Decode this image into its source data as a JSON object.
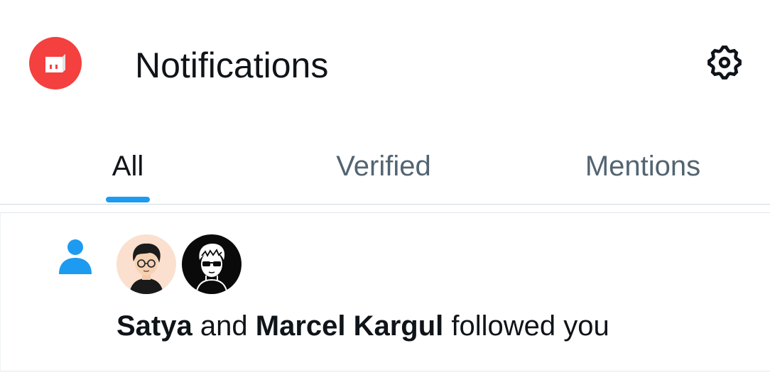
{
  "header": {
    "title": "Notifications",
    "avatar_icon": "app-logo-icon",
    "settings_icon": "gear-icon"
  },
  "tabs": [
    {
      "label": "All",
      "active": true
    },
    {
      "label": "Verified",
      "active": false
    },
    {
      "label": "Mentions",
      "active": false
    }
  ],
  "notification": {
    "type_icon": "person-icon",
    "user1": "Satya",
    "connector": "and",
    "user2": "Marcel Kargul",
    "action": "followed you"
  },
  "colors": {
    "accent": "#1d9bf0",
    "logo_bg": "#f4403f",
    "text_primary": "#0f1419",
    "text_secondary": "#536471"
  }
}
